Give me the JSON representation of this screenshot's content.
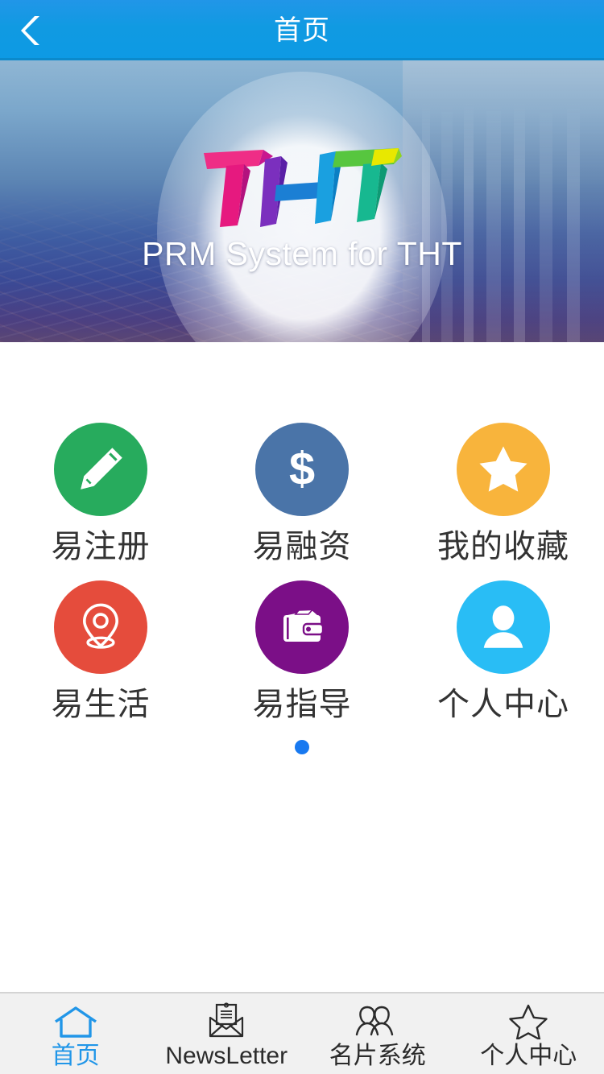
{
  "header": {
    "title": "首页",
    "back_icon": "chevron-left-icon",
    "bg_color": "#109ae2"
  },
  "banner": {
    "logo_text": "THT",
    "tagline": "PRM  System for THT",
    "logo_colors": [
      "#e6197f",
      "#7b2fbe",
      "#1aa0e0",
      "#0d7bd6",
      "#17b890",
      "#3fc34a",
      "#b6e021",
      "#f2e600"
    ]
  },
  "grid": {
    "items": [
      {
        "label": "易注册",
        "icon": "pen-icon",
        "color": "#27ab5d"
      },
      {
        "label": "易融资",
        "icon": "dollar-icon",
        "color": "#4a74a8"
      },
      {
        "label": "我的收藏",
        "icon": "star-icon",
        "color": "#f8b43c"
      },
      {
        "label": "易生活",
        "icon": "map-pin-icon",
        "color": "#e54c3c"
      },
      {
        "label": "易指导",
        "icon": "wallet-icon",
        "color": "#7b0f87"
      },
      {
        "label": "个人中心",
        "icon": "person-icon",
        "color": "#29bdf5"
      }
    ],
    "pager": {
      "count": 1,
      "active_index": 0,
      "active_color": "#1879f0"
    }
  },
  "tabbar": {
    "active_index": 0,
    "active_color": "#2196e8",
    "tabs": [
      {
        "label": "首页",
        "icon": "home-icon"
      },
      {
        "label": "NewsLetter",
        "icon": "envelope-document-icon"
      },
      {
        "label": "名片系统",
        "icon": "two-people-icon"
      },
      {
        "label": "个人中心",
        "icon": "star-outline-icon"
      }
    ]
  }
}
